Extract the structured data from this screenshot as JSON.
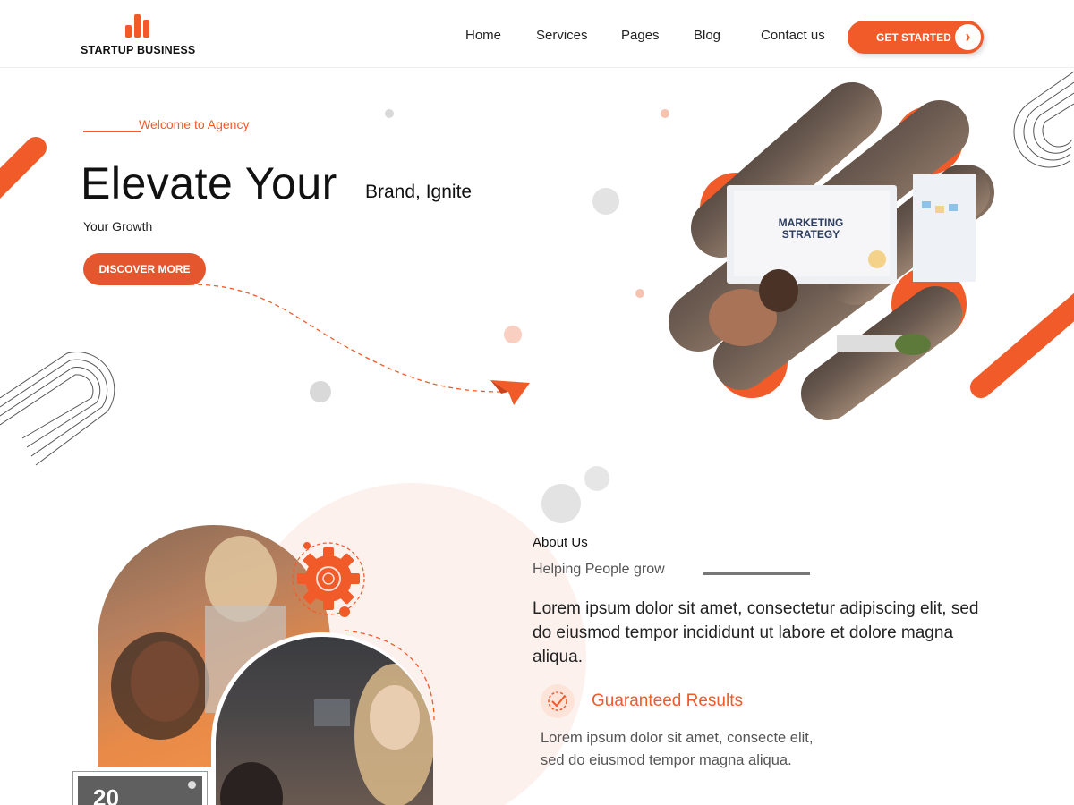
{
  "header": {
    "logo_text": "STARTUP BUSINESS",
    "nav": [
      "Home",
      "Services",
      "Pages",
      "Blog",
      "Contact us"
    ],
    "cta_label": "GET STARTED"
  },
  "hero": {
    "welcome": "Welcome to Agency",
    "title_big": "Elevate Your",
    "title_small": "Brand, Ignite",
    "subtitle": "Your Growth",
    "button_label": "DISCOVER MORE",
    "image_text": [
      "MARKETING",
      "STRATEGY"
    ]
  },
  "about": {
    "label": "About Us",
    "heading": "Helping People grow",
    "paragraph": "Lorem ipsum dolor sit amet, consectetur adipiscing elit, sed do eiusmod tempor incididunt ut labore et dolore magna aliqua.",
    "feature_title": "Guaranteed Results",
    "feature_text": "Lorem ipsum dolor sit amet, consecte elit, sed do eiusmod tempor magna aliqua.",
    "counter": "20"
  },
  "colors": {
    "accent": "#f15a29",
    "accent_light": "#fde3d8",
    "text_dark": "#111111",
    "muted": "#555555"
  },
  "icons": [
    "logo-bars-icon",
    "chevron-right-icon",
    "paper-plane-icon",
    "gear-icon",
    "checkmark-icon"
  ]
}
